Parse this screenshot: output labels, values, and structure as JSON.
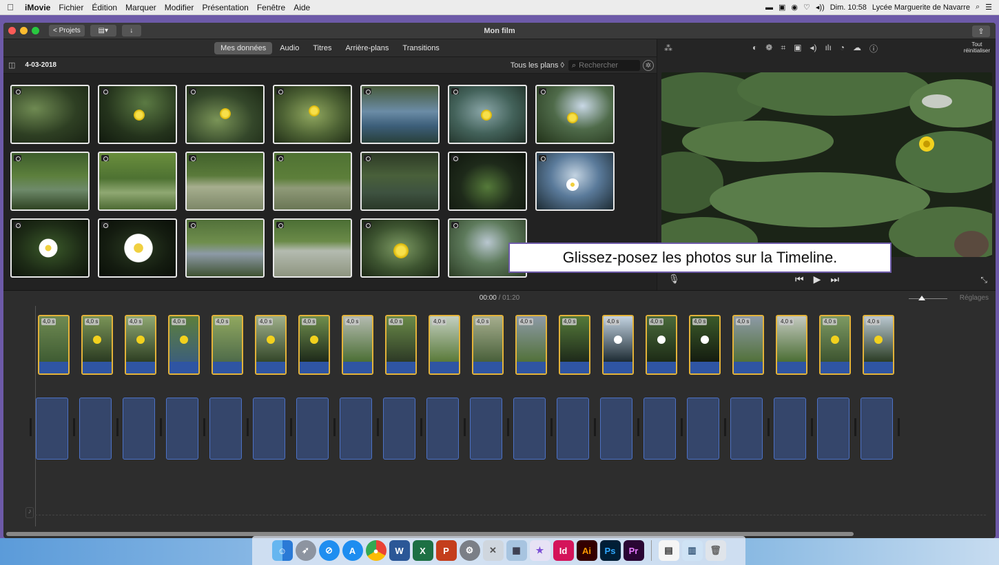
{
  "menubar": {
    "app": "iMovie",
    "menus": [
      "Fichier",
      "Édition",
      "Marquer",
      "Modifier",
      "Présentation",
      "Fenêtre",
      "Aide"
    ],
    "clock": "Dim. 10:58",
    "user": "Lycée Marguerite de Navarre"
  },
  "window": {
    "title": "Mon film",
    "back_label": "< Projets"
  },
  "browser": {
    "tabs": [
      "Mes données",
      "Audio",
      "Titres",
      "Arrière-plans",
      "Transitions"
    ],
    "active_tab": "Mes données",
    "date": "4-03-2018",
    "filter": "Tous les plans ◊",
    "search_placeholder": "Rechercher"
  },
  "viewer": {
    "reset_line1": "Tout",
    "reset_line2": "réinitialiser"
  },
  "timeline": {
    "current_time": "00:00",
    "separator": " / ",
    "total_time": "01:20",
    "settings": "Réglages",
    "clip_duration": "4,0 s"
  },
  "tooltip": "Glissez-posez les photos sur la Timeline.",
  "dock": {
    "apps": [
      "finder-icon",
      "launchpad-icon",
      "safari-icon",
      "appstore-icon",
      "chrome-icon",
      "word-icon",
      "excel-icon",
      "powerpoint-icon",
      "preferences-icon",
      "preview-icon",
      "photos-icon",
      "imovie-icon",
      "indesign-icon",
      "illustrator-icon",
      "photoshop-icon",
      "premiere-icon"
    ],
    "indesign": "Id",
    "illustrator": "Ai",
    "photoshop": "Ps",
    "premiere": "Pr"
  }
}
